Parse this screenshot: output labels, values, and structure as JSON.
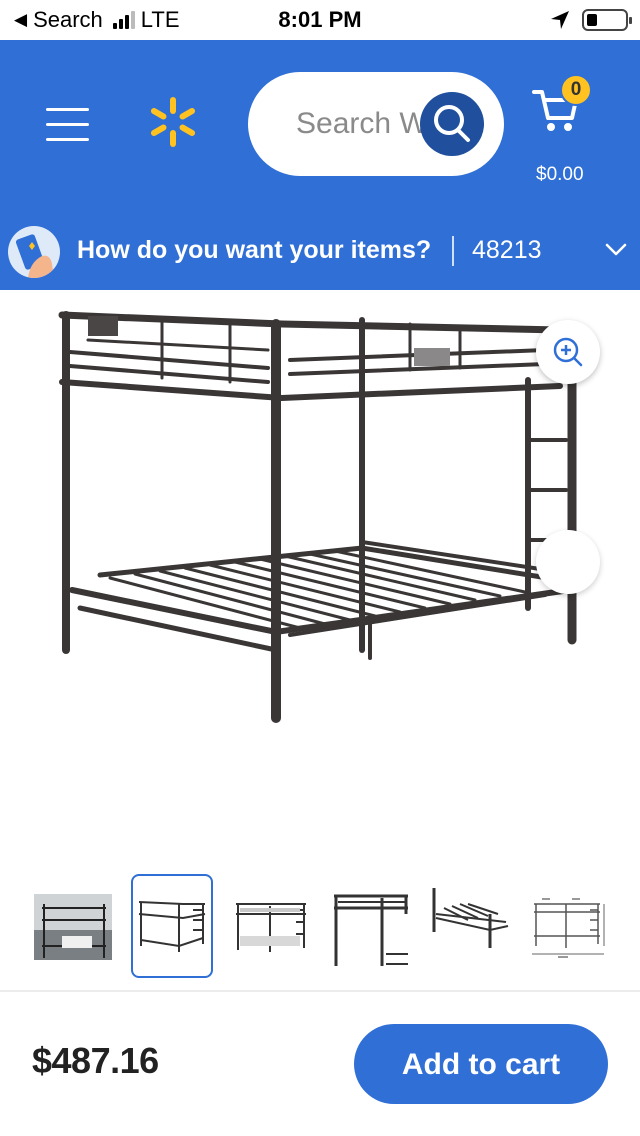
{
  "status_bar": {
    "back_label": "Search",
    "network": "LTE",
    "time": "8:01 PM"
  },
  "header": {
    "background_color": "#2f6fd6",
    "search_placeholder": "Search Walmart",
    "cart_count": "0",
    "cart_total": "$0.00"
  },
  "delivery": {
    "prompt": "How do you want your items?",
    "zip": "48213"
  },
  "gallery": {
    "thumbnail_count": 6,
    "selected_index": 1
  },
  "footer": {
    "price": "$487.16",
    "add_to_cart_label": "Add to cart",
    "button_color": "#2f6fd6"
  }
}
